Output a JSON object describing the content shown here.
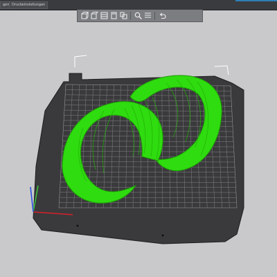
{
  "window": {
    "tabs": [
      {
        "label": "gen"
      },
      {
        "label": "Druckeinstellungen"
      }
    ]
  },
  "toolbar": {
    "buttons": [
      {
        "name": "add-object-button",
        "icon": "cube-add-icon"
      },
      {
        "name": "delete-object-button",
        "icon": "cube-delete-icon"
      },
      {
        "name": "arrange-button",
        "icon": "grid-arrange-icon"
      },
      {
        "name": "copy-button",
        "icon": "copy-icon"
      },
      {
        "name": "paste-button",
        "icon": "paste-icon"
      },
      {
        "name": "search-button",
        "icon": "magnifier-icon"
      },
      {
        "name": "layers-button",
        "icon": "layers-icon"
      },
      {
        "name": "undo-button",
        "icon": "undo-arrow-icon"
      }
    ]
  },
  "viewport": {
    "background": "#c9c9cb",
    "bed_color": "#3a3a3c",
    "grid_color": "#8f8f93",
    "model_color": "#2fdc0f",
    "model": "ram-horns",
    "axes": [
      "x-axis-red",
      "y-axis-green",
      "z-axis-blue"
    ]
  }
}
